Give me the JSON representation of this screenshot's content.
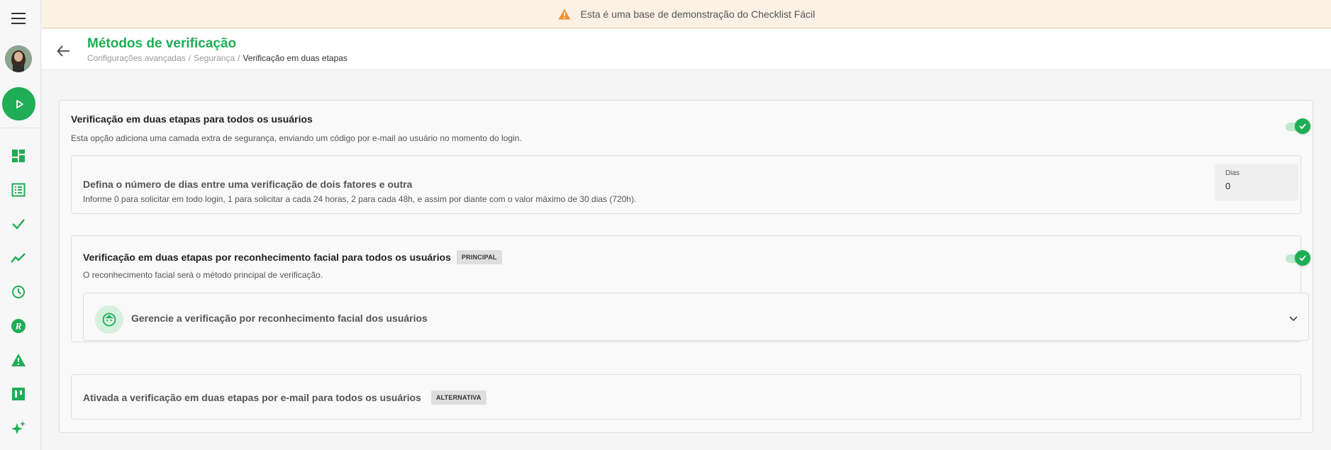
{
  "banner": {
    "text": "Esta é uma base de demonstração do Checklist Fácil",
    "icon": "warning-icon",
    "accent": "#f0912f"
  },
  "header": {
    "title": "Métodos de verificação",
    "breadcrumb": [
      "Configurações avançadas",
      "Segurança",
      "Verificação em duas etapas"
    ],
    "separator": "/"
  },
  "sidebar": {
    "icons": [
      "menu-icon",
      "avatar",
      "play-icon",
      "dashboard-icon",
      "checklist-icon",
      "check-icon",
      "trending-icon",
      "clock-icon",
      "r-logo-icon",
      "warning-icon",
      "board-icon",
      "sparkle-icon"
    ]
  },
  "two_factor": {
    "title": "Verificação em duas etapas para todos os usuários",
    "description": "Esta opção adiciona uma camada extra de segurança, enviando um código por e-mail ao usuário no momento do login.",
    "enabled": true,
    "days": {
      "title": "Defina o número de dias entre uma verificação de dois fatores e outra",
      "description": "Informe 0 para solicitar em todo login, 1 para solicitar a cada 24 horas, 2 para cada 48h, e assim por diante com o valor máximo de 30 dias (720h).",
      "field_label": "Dias",
      "field_value": "0"
    }
  },
  "facial": {
    "title": "Verificação em duas etapas por reconhecimento facial para todos os usuários",
    "badge": "PRINCIPAL",
    "description": "O reconhecimento facial será o método principal de verificação.",
    "enabled": true,
    "manage_label": "Gerencie a verificação por reconhecimento facial dos usuários"
  },
  "email": {
    "title": "Ativada a verificação em duas etapas por e-mail para todos os usuários",
    "badge": "ALTERNATIVA"
  },
  "colors": {
    "brand": "#1fad55",
    "toggle_track": "#bfe8cd"
  }
}
